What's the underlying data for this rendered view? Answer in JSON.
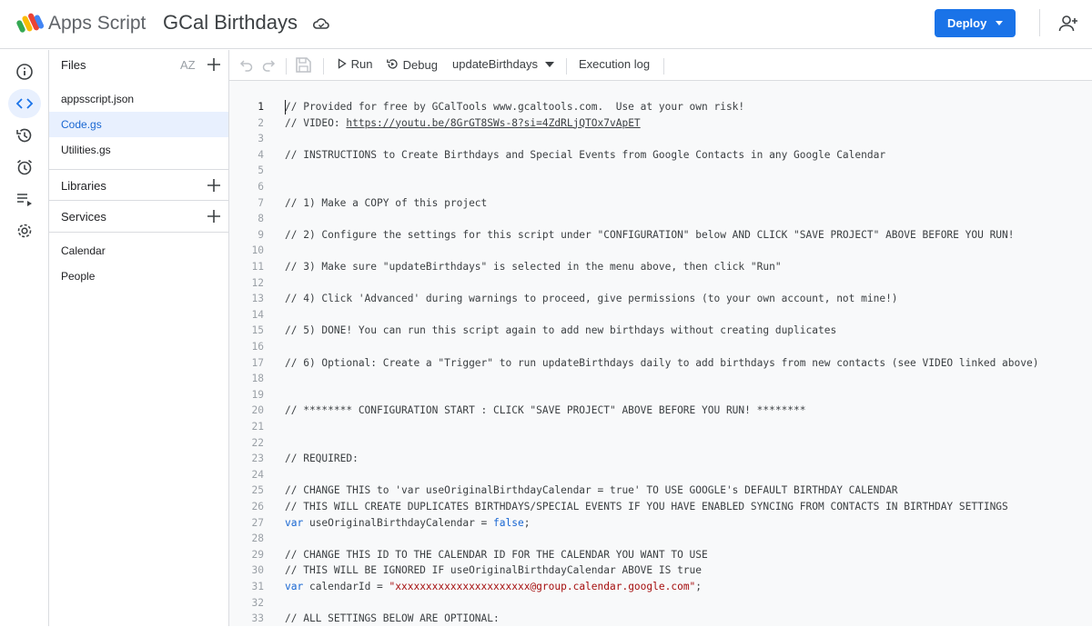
{
  "header": {
    "app_name": "Apps Script",
    "project_title": "GCal Birthdays",
    "deploy_label": "Deploy"
  },
  "files": {
    "title": "Files",
    "sort_label": "AZ",
    "items": [
      "appsscript.json",
      "Code.gs",
      "Utilities.gs"
    ],
    "selected": "Code.gs"
  },
  "libraries": {
    "label": "Libraries"
  },
  "services": {
    "label": "Services",
    "items": [
      "Calendar",
      "People"
    ]
  },
  "toolbar": {
    "run_label": "Run",
    "debug_label": "Debug",
    "function_select": "updateBirthdays",
    "execution_log_label": "Execution log"
  },
  "editor": {
    "current_line": 1,
    "lines": [
      {
        "n": "1",
        "t": "// Provided for free by GCalTools www.gcaltools.com.  Use at your own risk!"
      },
      {
        "n": "2",
        "t": "// VIDEO: ",
        "url": "https://youtu.be/8GrGT8SWs-8?si=4ZdRLjQTOx7vApET"
      },
      {
        "n": "3",
        "t": ""
      },
      {
        "n": "4",
        "t": "// INSTRUCTIONS to Create Birthdays and Special Events from Google Contacts in any Google Calendar"
      },
      {
        "n": "5",
        "t": ""
      },
      {
        "n": "6",
        "t": ""
      },
      {
        "n": "7",
        "t": "// 1) Make a COPY of this project"
      },
      {
        "n": "8",
        "t": ""
      },
      {
        "n": "9",
        "t": "// 2) Configure the settings for this script under \"CONFIGURATION\" below AND CLICK \"SAVE PROJECT\" ABOVE BEFORE YOU RUN!"
      },
      {
        "n": "10",
        "t": ""
      },
      {
        "n": "11",
        "t": "// 3) Make sure \"updateBirthdays\" is selected in the menu above, then click \"Run\""
      },
      {
        "n": "12",
        "t": ""
      },
      {
        "n": "13",
        "t": "// 4) Click 'Advanced' during warnings to proceed, give permissions (to your own account, not mine!)"
      },
      {
        "n": "14",
        "t": ""
      },
      {
        "n": "15",
        "t": "// 5) DONE! You can run this script again to add new birthdays without creating duplicates"
      },
      {
        "n": "16",
        "t": ""
      },
      {
        "n": "17",
        "t": "// 6) Optional: Create a \"Trigger\" to run updateBirthdays daily to add birthdays from new contacts (see VIDEO linked above)"
      },
      {
        "n": "18",
        "t": ""
      },
      {
        "n": "19",
        "t": ""
      },
      {
        "n": "20",
        "t": "// ******** CONFIGURATION START : CLICK \"SAVE PROJECT\" ABOVE BEFORE YOU RUN! ********"
      },
      {
        "n": "21",
        "t": ""
      },
      {
        "n": "22",
        "t": ""
      },
      {
        "n": "23",
        "t": "// REQUIRED:"
      },
      {
        "n": "24",
        "t": ""
      },
      {
        "n": "25",
        "t": "// CHANGE THIS to 'var useOriginalBirthdayCalendar = true' TO USE GOOGLE's DEFAULT BIRTHDAY CALENDAR"
      },
      {
        "n": "26",
        "t": "// THIS WILL CREATE DUPLICATES BIRTHDAYS/SPECIAL EVENTS IF YOU HAVE ENABLED SYNCING FROM CONTACTS IN BIRTHDAY SETTINGS"
      },
      {
        "n": "27",
        "kw": "var",
        "t": " useOriginalBirthdayCalendar = ",
        "lit": "false",
        "end": ";"
      },
      {
        "n": "28",
        "t": ""
      },
      {
        "n": "29",
        "t": "// CHANGE THIS ID TO THE CALENDAR ID FOR THE CALENDAR YOU WANT TO USE"
      },
      {
        "n": "30",
        "t": "// THIS WILL BE IGNORED IF useOriginalBirthdayCalendar ABOVE IS true"
      },
      {
        "n": "31",
        "kw": "var",
        "t": " calendarId = ",
        "str": "\"xxxxxxxxxxxxxxxxxxxxxx@group.calendar.google.com\"",
        "end": ";"
      },
      {
        "n": "32",
        "t": ""
      },
      {
        "n": "33",
        "t": "// ALL SETTINGS BELOW ARE OPTIONAL:"
      }
    ]
  }
}
